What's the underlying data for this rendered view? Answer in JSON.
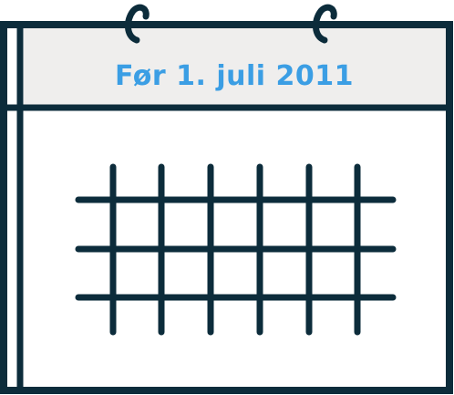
{
  "calendar": {
    "header_text": "Før 1. juli 2011",
    "colors": {
      "outline": "#0c2c3b",
      "header_background": "#efeeed",
      "header_text": "#3b9ee4",
      "page_background": "#ffffff"
    },
    "icon": "calendar-icon",
    "rings": [
      "binder-ring-icon",
      "binder-ring-icon"
    ]
  }
}
